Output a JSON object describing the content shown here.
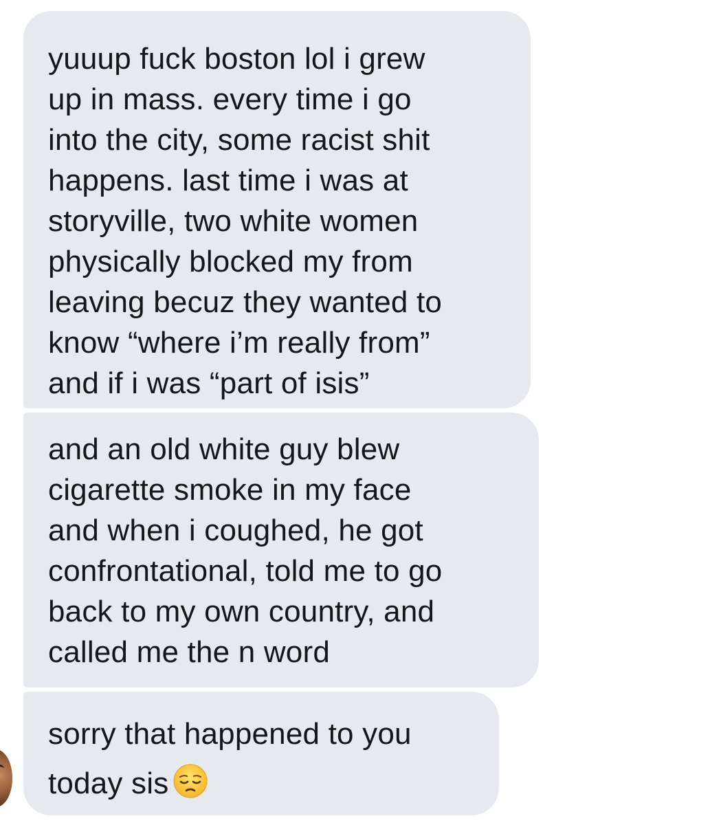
{
  "conversation": {
    "messages": [
      {
        "text": "yuuup fuck boston lol i grew\nup in mass. every time i go\ninto the city, some racist shit\nhappens. last time i was at\nstoryville, two white women\nphysically blocked my from\nleaving becuz they wanted to\nknow “where i’m really from”\nand if i was “part of isis”"
      },
      {
        "text": "and an old white guy blew\ncigarette smoke in my face\nand when i coughed, he got\nconfrontational, told me to go\nback to my own country, and\ncalled me the n word"
      },
      {
        "text": "sorry that happened to you\ntoday sis",
        "emoji": "pensive-face-emoji"
      }
    ],
    "colors": {
      "bubble_background": "#e6e9ee",
      "text": "#14171a",
      "page_background": "#ffffff"
    }
  }
}
